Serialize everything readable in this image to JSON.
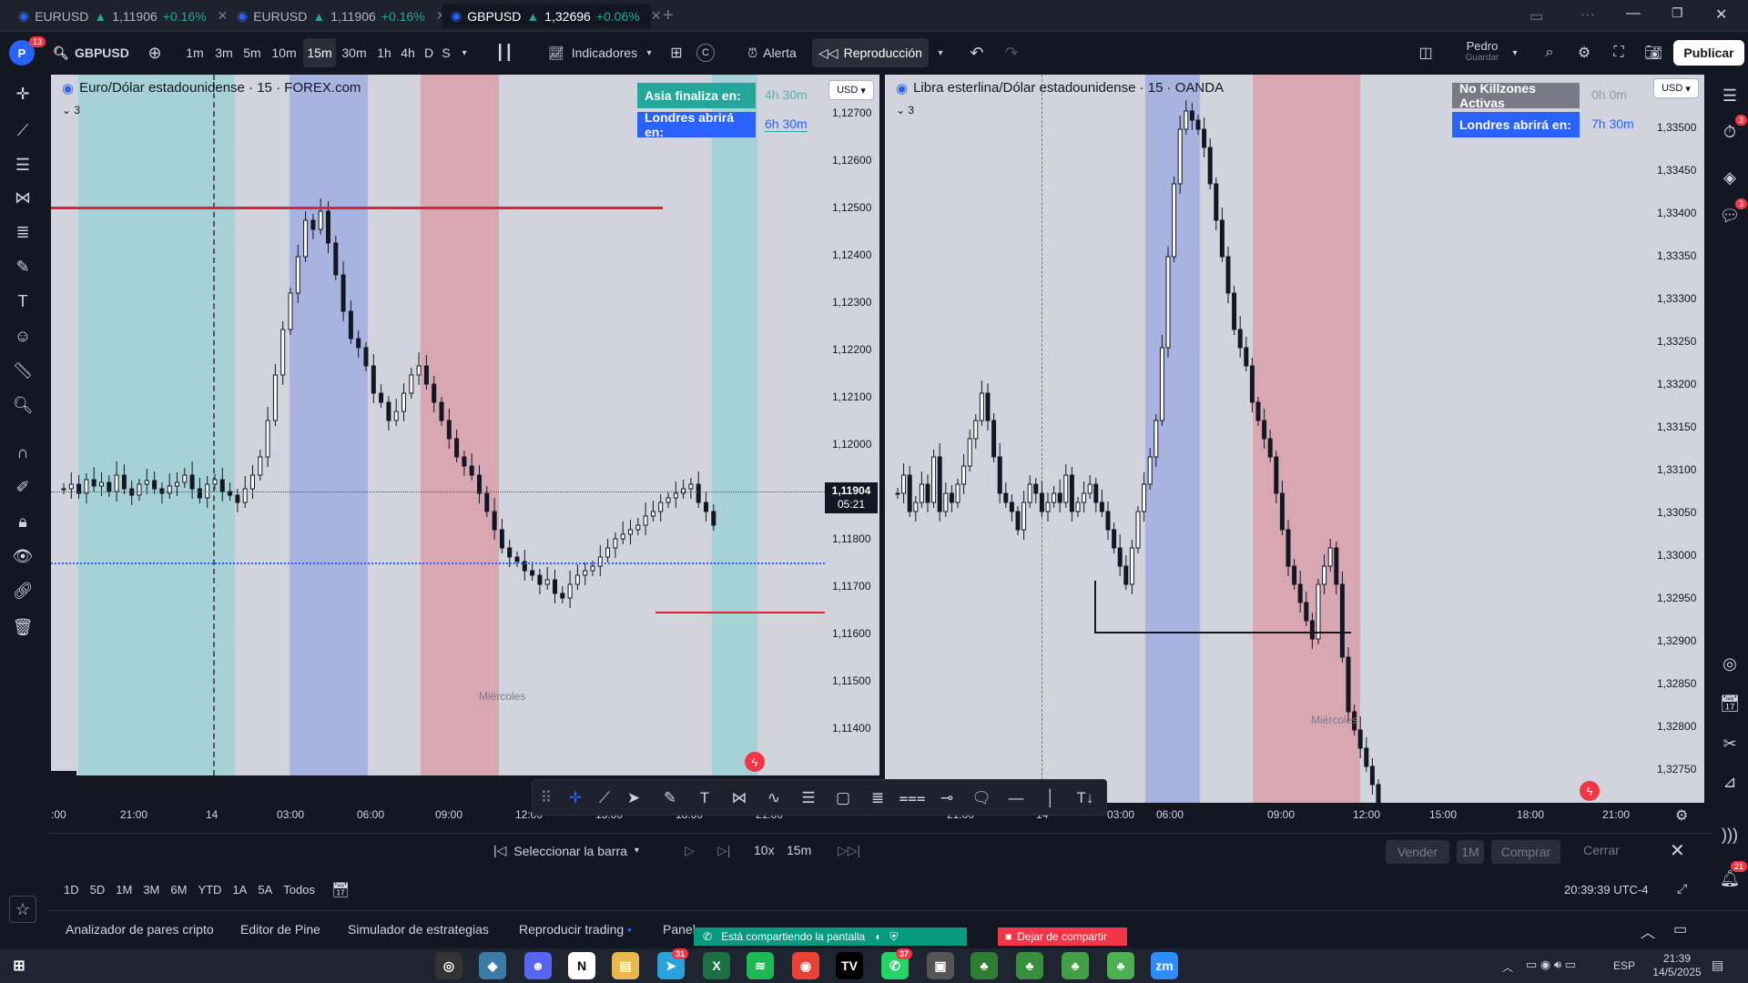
{
  "tabs": [
    {
      "symbol": "EURUSD",
      "price": "1,11906",
      "change": "+0.16%"
    },
    {
      "symbol": "EURUSD",
      "price": "1,11906",
      "change": "+0.16%"
    },
    {
      "symbol": "GBPUSD",
      "price": "1,32696",
      "change": "+0.06%"
    }
  ],
  "header": {
    "avatar_letter": "P",
    "notif_count": "13",
    "symbol": "GBPUSD",
    "timeframes": [
      "1m",
      "3m",
      "5m",
      "10m",
      "15m",
      "30m",
      "1h",
      "4h",
      "D",
      "S"
    ],
    "selected_timeframe": "15m",
    "indicators_label": "Indicadores",
    "c_label": "C",
    "alert_label": "Alerta",
    "replay_label": "Reproducción",
    "user_name": "Pedro",
    "save_label": "Guardar",
    "publish_label": "Publicar"
  },
  "left_chart": {
    "title": "Euro/Dólar estadounidense · 15 · FOREX.com",
    "count": "3",
    "currency": "USD",
    "asia_label": "Asia finaliza en:",
    "asia_time": "4h 30m",
    "london_label": "Londres abrirá en:",
    "london_time": "6h 30m",
    "price_ticks": [
      "1,12700",
      "1,12600",
      "1,12500",
      "1,12400",
      "1,12300",
      "1,12200",
      "1,12100",
      "1,12000",
      "1,11800",
      "1,11700",
      "1,11600",
      "1,11500",
      "1,11400"
    ],
    "current_price": "1,11904",
    "countdown": "05:21",
    "day_label": "Miércoles",
    "time_ticks": [
      ":00",
      "21:00",
      "14",
      "03:00",
      "06:00",
      "09:00",
      "12:00",
      "15:00",
      "18:00",
      "21:00"
    ]
  },
  "right_chart": {
    "title": "Libra esterlina/Dólar estadounidense · 15 · OANDA",
    "count": "3",
    "currency": "USD",
    "killzone_label": "No Killzones Activas",
    "killzone_time": "0h 0m",
    "london_label": "Londres abrirá en:",
    "london_time": "7h 30m",
    "price_ticks": [
      "1,33500",
      "1,33450",
      "1,33400",
      "1,33350",
      "1,33300",
      "1,33250",
      "1,33200",
      "1,33150",
      "1,33100",
      "1,33050",
      "1,33000",
      "1,32950",
      "1,32900",
      "1,32850",
      "1,32800",
      "1,32750"
    ],
    "day_label": "Miércoles",
    "time_ticks": [
      "21:00",
      "14",
      "03:00",
      "06:00",
      "09:00",
      "12:00",
      "15:00",
      "18:00",
      "21:00"
    ]
  },
  "replay": {
    "select_bar_label": "Seleccionar la barra",
    "speed": "10x",
    "interval": "15m",
    "sell_label": "Vender",
    "qty_label": "1M",
    "buy_label": "Comprar",
    "close_label": "Cerrar"
  },
  "ranges": [
    "1D",
    "5D",
    "1M",
    "3M",
    "6M",
    "YTD",
    "1A",
    "5A",
    "Todos"
  ],
  "clock": "20:39:39 UTC-4",
  "bottom_tabs": [
    "Analizador de pares cripto",
    "Editor de Pine",
    "Simulador de estrategias",
    "Reproducir trading",
    "Panel"
  ],
  "share_notice": {
    "text": "Está compartiendo la pantalla",
    "stop_label": "Dejar de compartir"
  },
  "taskbar": {
    "lang": "ESP",
    "time": "21:39",
    "date": "14/5/2025",
    "notif": "21",
    "telegram_badge": "31",
    "whatsapp_badge": "37"
  },
  "colors": {
    "bg": "#131722",
    "asia_band": "#a6d1d6",
    "london_band": "#a8b3e0",
    "ny_band": "#d9a7b2",
    "red_line": "#e0213a",
    "blue_box": "#2962ff",
    "teal_box": "#26a69a"
  }
}
